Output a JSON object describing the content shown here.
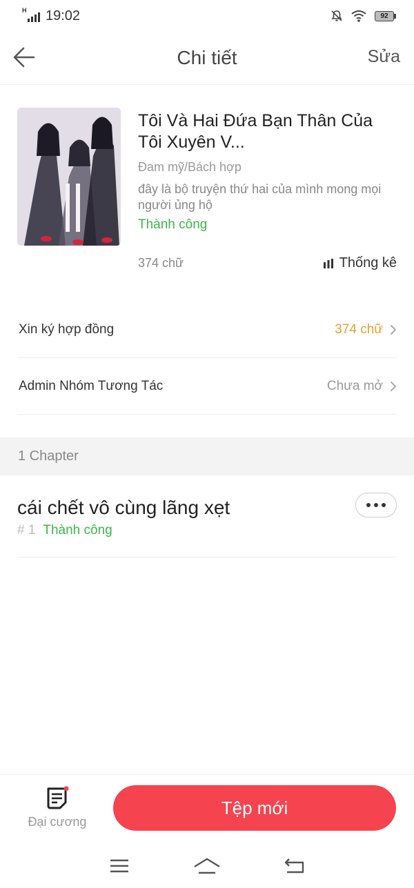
{
  "status_bar": {
    "network": "H",
    "time": "19:02",
    "battery": "92"
  },
  "header": {
    "title": "Chi tiết",
    "edit_label": "Sửa"
  },
  "book": {
    "title": "Tôi Và Hai Đứa Bạn Thân Của Tôi Xuyên V...",
    "category": "Đam mỹ/Bách hợp",
    "description": "đây là bộ truyện thứ hai của mình mong mọi người ủng hộ",
    "status": "Thành công",
    "word_count": "374 chữ",
    "stats_label": "Thống kê"
  },
  "rows": [
    {
      "label": "Xin ký hợp đồng",
      "value": "374 chữ"
    },
    {
      "label": "Admin Nhóm Tương Tác",
      "value": "Chưa mở"
    }
  ],
  "section": {
    "header": "1 Chapter"
  },
  "chapters": [
    {
      "title": "cái chết vô cùng lãng xẹt",
      "number": "# 1",
      "status": "Thành công"
    }
  ],
  "bottom_bar": {
    "outline_label": "Đại cương",
    "new_file_label": "Tệp mới"
  },
  "colors": {
    "accent_red": "#f5434f",
    "success_green": "#3bb54a",
    "value_orange": "#e5a22b"
  },
  "icons": [
    "back-arrow-icon",
    "bar-chart-icon",
    "chevron-right-icon",
    "more-dots-icon",
    "outline-notebook-icon",
    "menu-icon",
    "home-icon",
    "return-icon",
    "mute-bell-icon",
    "wifi-icon",
    "battery-icon",
    "signal-icon"
  ]
}
